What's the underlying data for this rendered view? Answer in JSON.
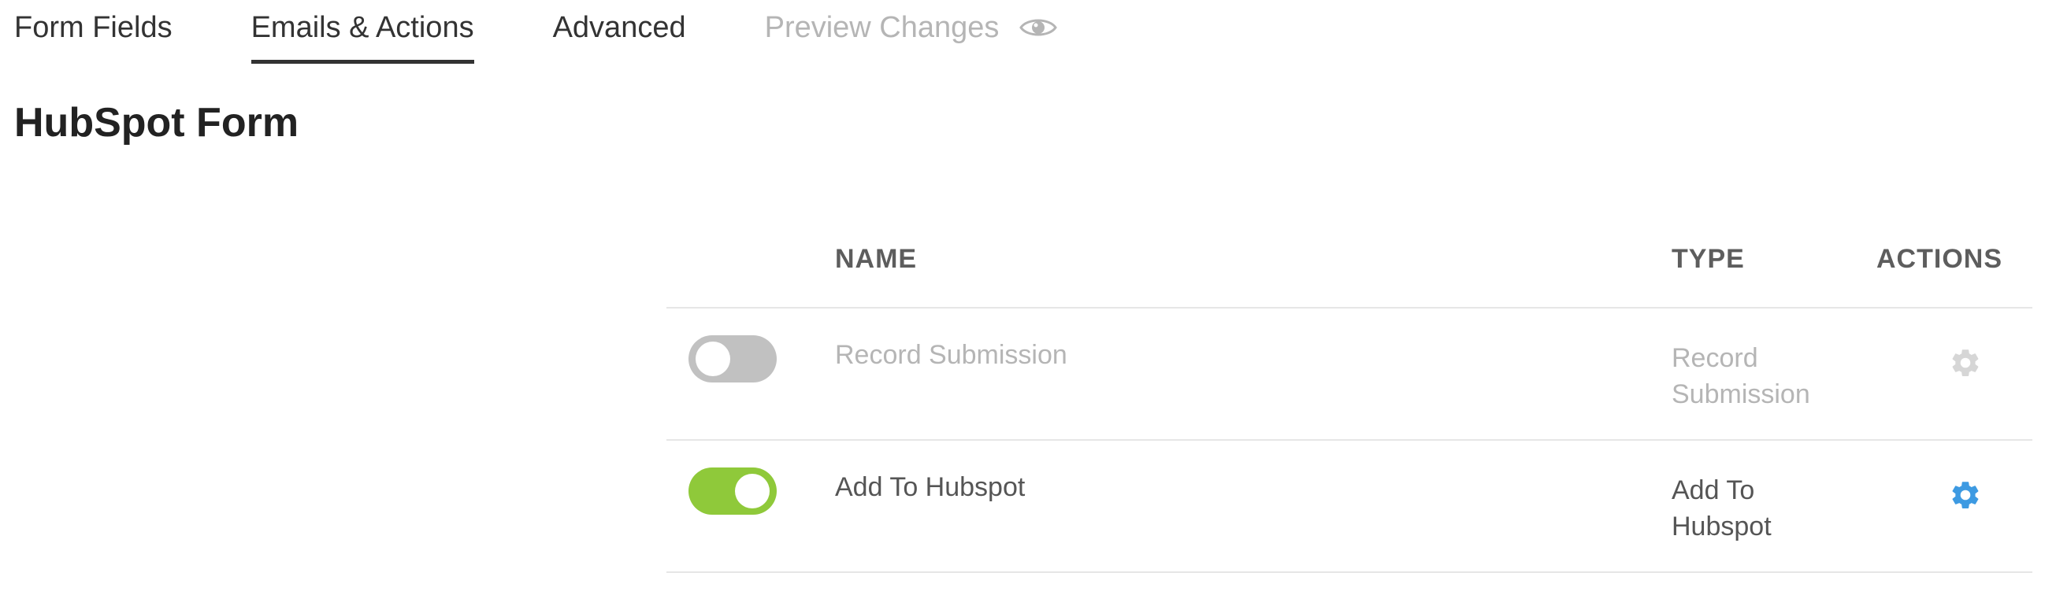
{
  "tabs": [
    {
      "label": "Form Fields",
      "state": "normal"
    },
    {
      "label": "Emails & Actions",
      "state": "active"
    },
    {
      "label": "Advanced",
      "state": "normal"
    },
    {
      "label": "Preview Changes",
      "state": "disabled",
      "icon": "eye-icon"
    }
  ],
  "page": {
    "title": "HubSpot Form"
  },
  "table": {
    "headers": {
      "name": "NAME",
      "type": "TYPE",
      "actions": "ACTIONS"
    },
    "rows": [
      {
        "enabled": false,
        "name": "Record Submission",
        "type": "Record Submission",
        "action_icon": "gear-icon"
      },
      {
        "enabled": true,
        "name": "Add To Hubspot",
        "type": "Add To Hubspot",
        "action_icon": "gear-icon"
      }
    ]
  },
  "colors": {
    "toggle_on": "#8fc93a",
    "toggle_off": "#c1c1c1",
    "gear_active": "#3d9ae2",
    "gear_inactive": "#d6d6d6",
    "text_disabled": "#b5b5b5",
    "text_primary": "#333333"
  }
}
